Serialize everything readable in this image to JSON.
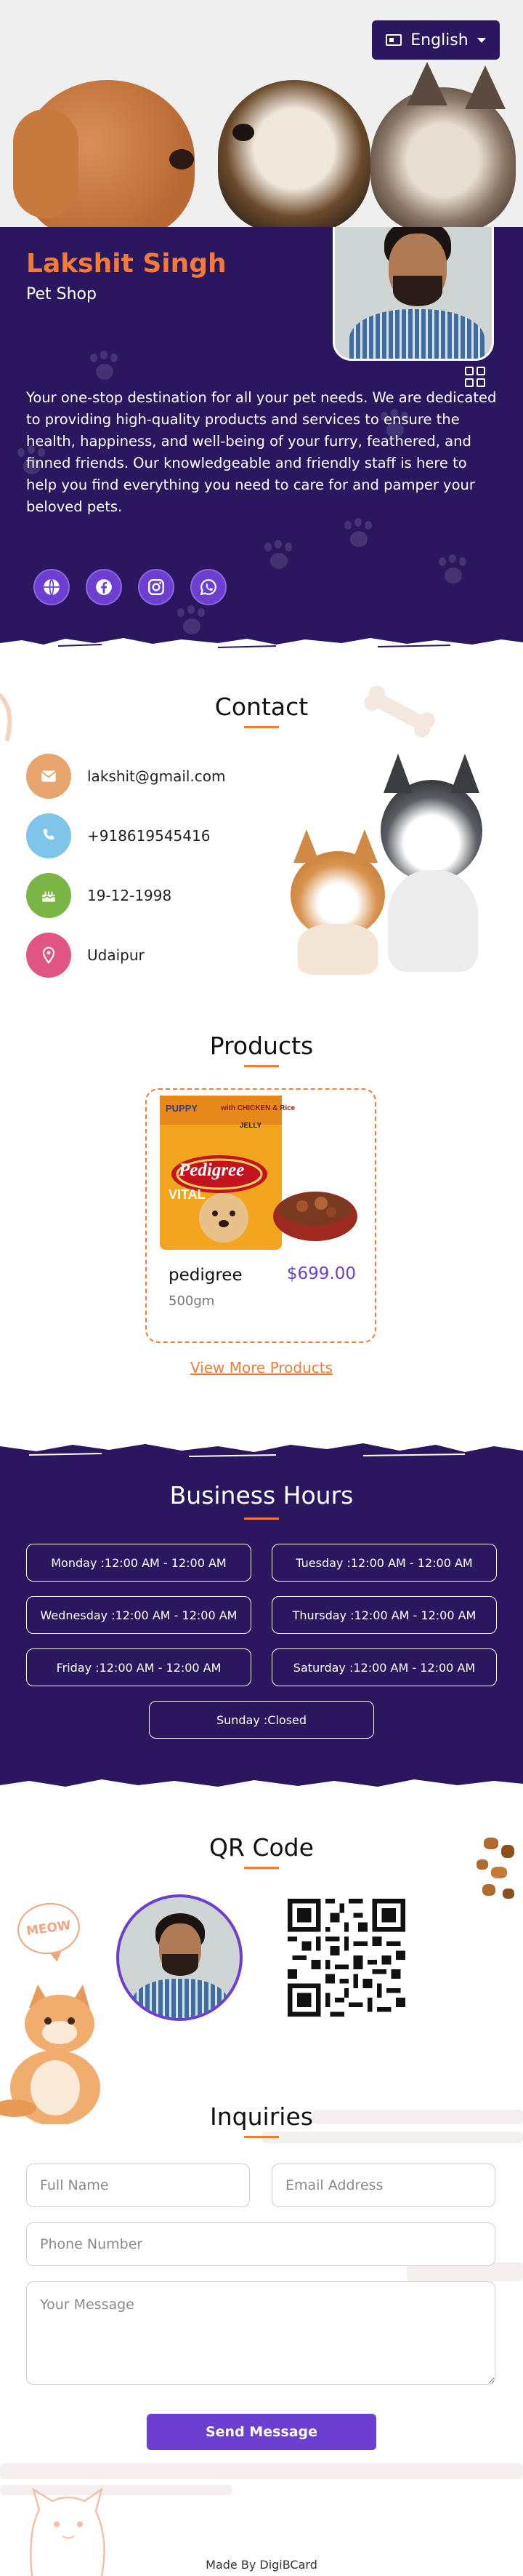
{
  "header": {
    "language_label": "English",
    "language_icon": "id-card-icon"
  },
  "profile": {
    "name": "Lakshit Singh",
    "category": "Pet Shop",
    "about": "Your one-stop destination for all your pet needs. We are dedicated to providing high-quality products and services to ensure the health, happiness, and well-being of your furry, feathered, and finned friends. Our knowledgeable and friendly staff is here to help you find everything you need to care for and pamper your beloved pets.",
    "socials": [
      {
        "icon": "globe-icon"
      },
      {
        "icon": "facebook-icon"
      },
      {
        "icon": "instagram-icon"
      },
      {
        "icon": "whatsapp-icon"
      }
    ]
  },
  "contact": {
    "title": "Contact",
    "email": "lakshit@gmail.com",
    "phone": "+918619545416",
    "dob": "19-12-1998",
    "location": "Udaipur"
  },
  "products": {
    "title": "Products",
    "items": [
      {
        "name": "pedigree",
        "price": "$699.00",
        "weight": "500gm",
        "pack_brand": "Pedigree",
        "pack_top": "PUPPY",
        "pack_flavor": "with CHICKEN & Rice",
        "pack_type": "JELLY",
        "pack_line": "VITAL"
      }
    ],
    "view_more": "View More Products"
  },
  "business_hours": {
    "title": "Business Hours",
    "days": [
      "Monday :12:00 AM - 12:00 AM",
      "Tuesday :12:00 AM - 12:00 AM",
      "Wednesday :12:00 AM - 12:00 AM",
      "Thursday :12:00 AM - 12:00 AM",
      "Friday :12:00 AM - 12:00 AM",
      "Saturday :12:00 AM - 12:00 AM",
      "Sunday :Closed"
    ]
  },
  "qr": {
    "title": "QR Code",
    "meow": "MEOW"
  },
  "inquiries": {
    "title": "Inquiries",
    "full_name_placeholder": "Full Name",
    "email_placeholder": "Email Address",
    "phone_placeholder": "Phone Number",
    "message_placeholder": "Your Message",
    "send_label": "Send Message"
  },
  "footer": {
    "text": "Made By DigiBCard"
  },
  "colors": {
    "primary": "#2a1760",
    "accent": "#f47b36",
    "button": "#6c3fd0",
    "email_icon_bg": "#e8a46d",
    "phone_icon_bg": "#7fc5e9",
    "dob_icon_bg": "#7ab545",
    "location_icon_bg": "#e05583"
  }
}
